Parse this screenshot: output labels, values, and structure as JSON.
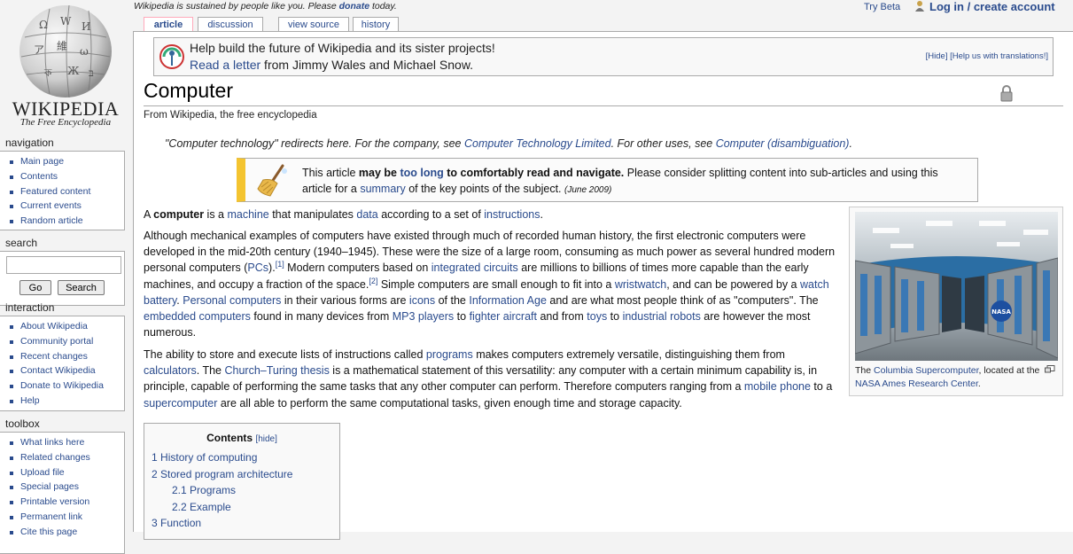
{
  "logo": {
    "wordmark": "WIKIPEDIA",
    "tagline": "The Free Encyclopedia"
  },
  "topbar": {
    "sustain_pre": "Wikipedia is sustained by people like you. Please ",
    "sustain_link": "donate",
    "sustain_post": " today.",
    "try_beta": "Try Beta",
    "login": "Log in / create account"
  },
  "tabs": [
    {
      "label": "article"
    },
    {
      "label": "discussion"
    },
    {
      "label": "view source"
    },
    {
      "label": "history"
    }
  ],
  "sidebar": {
    "navigation": {
      "title": "navigation",
      "items": [
        "Main page",
        "Contents",
        "Featured content",
        "Current events",
        "Random article"
      ]
    },
    "search": {
      "title": "search",
      "go": "Go",
      "search": "Search",
      "value": ""
    },
    "interaction": {
      "title": "interaction",
      "items": [
        "About Wikipedia",
        "Community portal",
        "Recent changes",
        "Contact Wikipedia",
        "Donate to Wikipedia",
        "Help"
      ]
    },
    "toolbox": {
      "title": "toolbox",
      "items": [
        "What links here",
        "Related changes",
        "Upload file",
        "Special pages",
        "Printable version",
        "Permanent link",
        "Cite this page"
      ]
    }
  },
  "sitenotice": {
    "line1": "Help build the future of Wikipedia and its sister projects!",
    "line2_link": "Read a letter",
    "line2_post": " from Jimmy Wales and Michael Snow.",
    "hide": "[Hide]",
    "help": "[Help us with translations!]"
  },
  "article": {
    "title": "Computer",
    "tagline": "From Wikipedia, the free encyclopedia",
    "hatnote": {
      "t1": "\"Computer technology\" redirects here. For the company, see ",
      "l1": "Computer Technology Limited",
      "t2": ". For other uses, see ",
      "l2": "Computer (disambiguation)",
      "t3": "."
    },
    "ambox": {
      "t1": "This article ",
      "b1": "may be ",
      "l1": "too long",
      "b2": " to comfortably read and navigate.",
      "t2": " Please consider splitting content into sub-articles and using this article for a ",
      "l2": "summary",
      "t3": " of the key points of the subject. ",
      "date": "(June 2009)"
    },
    "p1": {
      "t1": "A ",
      "b1": "computer",
      "t2": " is a ",
      "l1": "machine",
      "t3": " that manipulates ",
      "l2": "data",
      "t4": " according to a set of ",
      "l3": "instructions",
      "t5": "."
    },
    "p2": {
      "t1": "Although mechanical examples of computers have existed through much of recorded human history, the first electronic computers were developed in the mid-20th century (1940–1945). These were the size of a large room, consuming as much power as several hundred modern personal computers (",
      "l1": "PCs",
      "t2": ").",
      "ref1": "[1]",
      "t3": " Modern computers based on ",
      "l2": "integrated circuits",
      "t4": " are millions to billions of times more capable than the early machines, and occupy a fraction of the space.",
      "ref2": "[2]",
      "t5": " Simple computers are small enough to fit into a ",
      "l3": "wristwatch",
      "t6": ", and can be powered by a ",
      "l4": "watch battery",
      "t7": ". ",
      "l5": "Personal computers",
      "t8": " in their various forms are ",
      "l6": "icons",
      "t9": " of the ",
      "l7": "Information Age",
      "t10": " and are what most people think of as \"computers\". The ",
      "l8": "embedded computers",
      "t11": " found in many devices from ",
      "l9": "MP3 players",
      "t12": " to ",
      "l10": "fighter aircraft",
      "t13": " and from ",
      "l11": "toys",
      "t14": " to ",
      "l12": "industrial robots",
      "t15": " are however the most numerous."
    },
    "p3": {
      "t1": "The ability to store and execute lists of instructions called ",
      "l1": "programs",
      "t2": " makes computers extremely versatile, distinguishing them from ",
      "l2": "calculators",
      "t3": ". The ",
      "l3": "Church–Turing thesis",
      "t4": " is a mathematical statement of this versatility: any computer with a certain minimum capability is, in principle, capable of performing the same tasks that any other computer can perform. Therefore computers ranging from a ",
      "l4": "mobile phone",
      "t5": " to a ",
      "l5": "supercomputer",
      "t6": " are all able to perform the same computational tasks, given enough time and storage capacity."
    },
    "thumb": {
      "t1": "The ",
      "l1": "Columbia Supercomputer",
      "t2": ", located at the ",
      "l2": "NASA Ames Research Center",
      "t3": "."
    },
    "toc": {
      "title": "Contents",
      "hide": "[hide]",
      "items": [
        {
          "num": "1",
          "label": "History of computing"
        },
        {
          "num": "2",
          "label": "Stored program architecture"
        },
        {
          "num": "2.1",
          "label": "Programs"
        },
        {
          "num": "2.2",
          "label": "Example"
        },
        {
          "num": "3",
          "label": "Function"
        }
      ]
    }
  },
  "colors": {
    "link": "#2a4b8d",
    "ambox_accent": "#f4c430",
    "sidebar_bg": "#f3f3f3"
  },
  "icons": [
    "wikipedia-globe-icon",
    "user-icon",
    "wikimedia-icon",
    "lock-icon",
    "broom-icon",
    "magnify-icon",
    "supercomputer-image"
  ]
}
